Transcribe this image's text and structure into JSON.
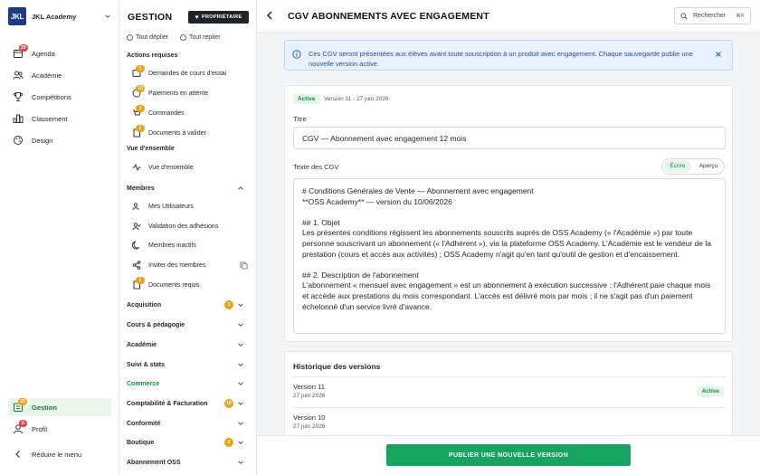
{
  "colors": {
    "accent_green": "#17a362",
    "brand_blue": "#1f3a8a",
    "info_bg": "#e8f2fe",
    "badge_red": "#e5484d",
    "badge_amber": "#e8a317"
  },
  "brand": {
    "logo_text": "JKL",
    "name": "JKL Academy"
  },
  "sidebar": {
    "items": [
      {
        "label": "Agenda",
        "icon": "calendar-icon",
        "badge": "20"
      },
      {
        "label": "Académie",
        "icon": "users-icon"
      },
      {
        "label": "Compétitions",
        "icon": "trophy-icon"
      },
      {
        "label": "Classement",
        "icon": "ranking-icon"
      },
      {
        "label": "Design",
        "icon": "palette-icon"
      }
    ],
    "bottom": [
      {
        "label": "Gestion",
        "icon": "gestion-icon",
        "badge": "33",
        "active": true
      },
      {
        "label": "Profil",
        "icon": "profile-icon",
        "badge": "6"
      },
      {
        "label": "Réduire le menu",
        "icon": "collapse-icon"
      }
    ]
  },
  "gestion": {
    "title": "GESTION",
    "owner_badge": "PROPRIÉTAIRE",
    "expand_all": "Tout déplier",
    "collapse_all": "Tout replier",
    "actions_title": "Actions requises",
    "actions": [
      {
        "label": "Demandes de cours d'essai",
        "badge": "1"
      },
      {
        "label": "Paiements en attente",
        "badge": "10"
      },
      {
        "label": "Commandes",
        "badge": "1"
      },
      {
        "label": "Documents à valider",
        "badge": "1"
      }
    ],
    "overview_title": "Vue d'ensemble",
    "overview_item": "Vue d'ensemble",
    "members_title": "Membres",
    "members": [
      {
        "label": "Mes Utilisateurs"
      },
      {
        "label": "Validation des adhésions"
      },
      {
        "label": "Membres inactifs"
      },
      {
        "label": "Inviter des membres"
      },
      {
        "label": "Documents requis",
        "badge": "1"
      }
    ],
    "sections": [
      {
        "label": "Acquisition",
        "badge": "1"
      },
      {
        "label": "Cours & pédagogie"
      },
      {
        "label": "Académie"
      },
      {
        "label": "Suivi & stats"
      },
      {
        "label": "Commerce",
        "highlight": true
      },
      {
        "label": "Comptabilité & Facturation",
        "badge": "10"
      },
      {
        "label": "Conformité"
      },
      {
        "label": "Boutique",
        "badge": "2"
      },
      {
        "label": "Abonnement OSS"
      }
    ]
  },
  "header": {
    "title": "CGV ABONNEMENTS AVEC ENGAGEMENT",
    "search_label": "Rechercher",
    "search_shortcut": "⌘K"
  },
  "info": {
    "text": "Ces CGV seront présentées aux élèves avant toute souscription à un produit avec engagement. Chaque sauvegarde publie une nouvelle version active."
  },
  "form": {
    "status": "Active",
    "version": "Version 11 - 27 juin 2026",
    "title_label": "Titre",
    "title_value": "CGV — Abonnement avec engagement 12 mois",
    "text_label": "Texte des CGV",
    "tab_write": "Écrire",
    "tab_preview": "Aperçu",
    "body": "# Conditions Générales de Vente — Abonnement avec engagement\n**OSS Academy** — version du 10/06/2026\n\n## 1. Objet\nLes présentes conditions régissent les abonnements souscrits auprès de OSS Academy (« l'Académie ») par toute personne souscrivant un abonnement (« l'Adhérent »), via la plateforme OSS Academy. L'Académie est le vendeur de la prestation (cours et accès aux activités) ; OSS Academy n'agit qu'en tant qu'outil de gestion et d'encaissement.\n\n## 2. Description de l'abonnement\nL'abonnement « mensuel avec engagement » est un abonnement à exécution successive : l'Adhérent paie chaque mois et accède aux prestations du mois correspondant. L'accès est délivré mois par mois ; il ne s'agit pas d'un paiement échelonné d'un service livré d'avance."
  },
  "history": {
    "title": "Historique des versions",
    "rows": [
      {
        "name": "Version 11",
        "date": "27 juin 2026",
        "status": "Active"
      },
      {
        "name": "Version 10",
        "date": "27 juin 2026"
      }
    ]
  },
  "footer": {
    "publish_label": "PUBLIER UNE NOUVELLE VERSION"
  }
}
